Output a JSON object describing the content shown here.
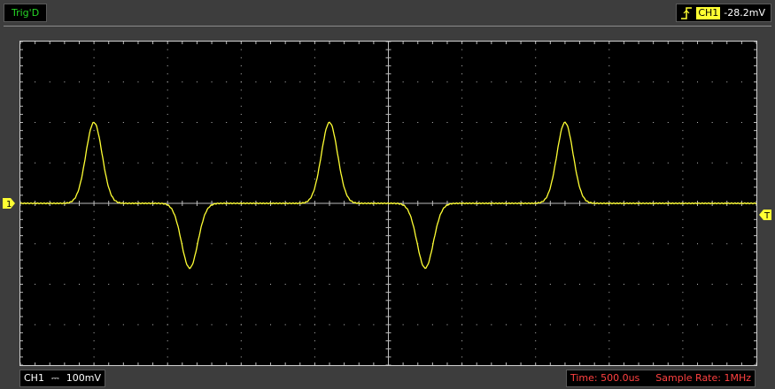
{
  "header": {
    "trigger_status": "Trig'D",
    "trigger_channel": "CH1",
    "trigger_level": "-28.2mV"
  },
  "footer": {
    "ch1_label": "CH1",
    "ch1_coupling": "⎓",
    "ch1_volts_div": "100mV",
    "time_label": "Time: 500.0us",
    "sample_rate_label": "Sample Rate: 1MHz"
  },
  "markers": {
    "channel_marker": "1",
    "trigger_marker": "T"
  },
  "colors": {
    "trace": "#ffff33",
    "grid": "#bdbdbd",
    "screen_bg": "#000000",
    "status_green": "#26d526",
    "readout_red": "#ff4040"
  },
  "waveform": {
    "pulses": [
      {
        "center_div": 1.0,
        "amplitude_div": 2.0
      },
      {
        "center_div": 2.3,
        "amplitude_div": -1.6
      },
      {
        "center_div": 4.2,
        "amplitude_div": 2.0
      },
      {
        "center_div": 5.5,
        "amplitude_div": -1.6
      },
      {
        "center_div": 7.4,
        "amplitude_div": 2.0
      }
    ],
    "pulse_halfwidth_div": 0.28
  }
}
